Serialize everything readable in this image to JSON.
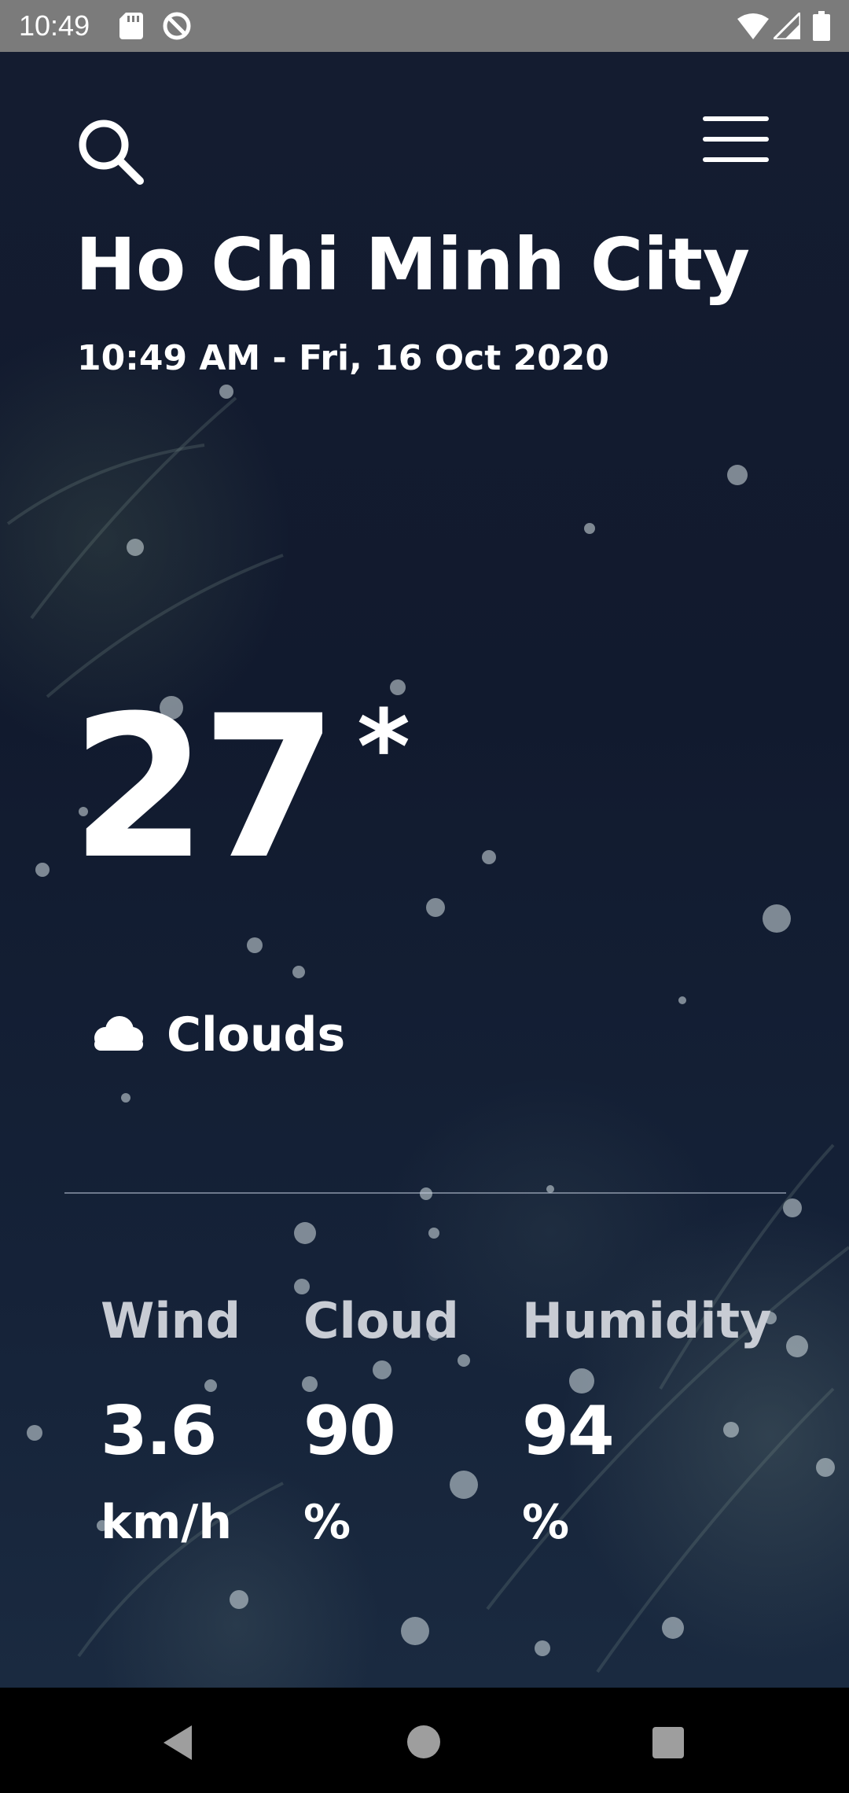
{
  "status_bar": {
    "time": "10:49",
    "icons": [
      "sd-card-icon",
      "do-not-disturb-icon",
      "wifi-icon",
      "signal-icon",
      "battery-icon"
    ]
  },
  "header": {
    "search_icon": "search-icon",
    "menu_icon": "hamburger-menu-icon"
  },
  "location": {
    "city": "Ho Chi Minh City",
    "datetime": "10:49 AM - Fri, 16 Oct 2020"
  },
  "current": {
    "temperature": "27",
    "unit_symbol": "*",
    "condition_icon": "cloud-icon",
    "condition": "Clouds"
  },
  "stats": [
    {
      "label": "Wind",
      "value": "3.6",
      "unit": "km/h"
    },
    {
      "label": "Cloud",
      "value": "90",
      "unit": "%"
    },
    {
      "label": "Humidity",
      "value": "94",
      "unit": "%"
    }
  ],
  "colors": {
    "background": "#111a2e",
    "text": "#ffffff",
    "label": "#c8ccd4",
    "status_bar": "#7b7b7b"
  },
  "nav_bar": {
    "icons": [
      "back-icon",
      "home-icon",
      "recents-icon"
    ]
  }
}
